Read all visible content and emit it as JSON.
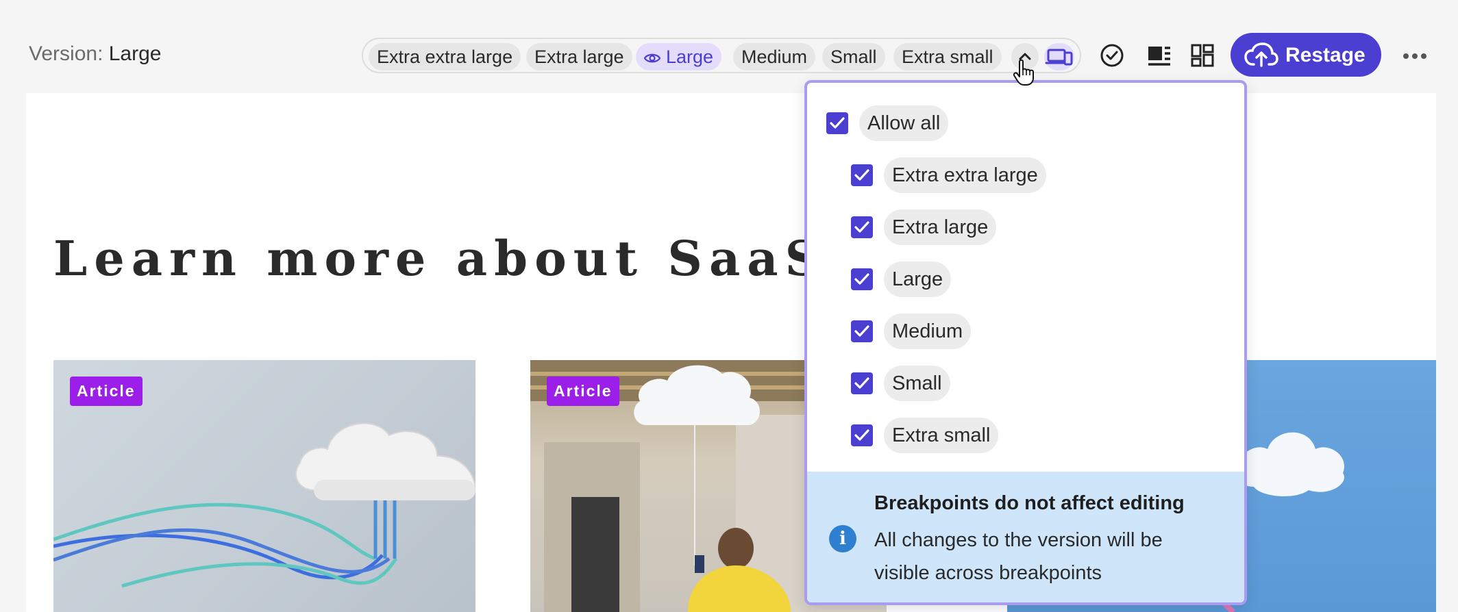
{
  "header": {
    "version_label": "Version:",
    "version_value": "Large"
  },
  "breakpoints_bar": {
    "chips": [
      {
        "label": "Extra extra large",
        "active": false
      },
      {
        "label": "Extra large",
        "active": false
      },
      {
        "label": "Large",
        "active": true
      },
      {
        "label": "Medium",
        "active": false
      },
      {
        "label": "Small",
        "active": false
      },
      {
        "label": "Extra small",
        "active": false
      }
    ],
    "toggle_icon": "chevron-up-icon",
    "devices_icon": "devices-icon"
  },
  "toolbar": {
    "check_icon": "check-circle-icon",
    "layout_icon": "image-text-icon",
    "grid_icon": "dashboard-grid-icon",
    "restage_label": "Restage",
    "restage_icon": "cloud-upload-icon",
    "more_icon": "more-horizontal-icon"
  },
  "canvas": {
    "headline": "Learn more about SaaS conte",
    "cards": [
      {
        "badge": "Article"
      },
      {
        "badge": "Article"
      },
      {
        "badge": ""
      }
    ]
  },
  "dropdown": {
    "allow_all_label": "Allow all",
    "allow_all_checked": true,
    "options": [
      {
        "label": "Extra extra large",
        "checked": true
      },
      {
        "label": "Extra large",
        "checked": true
      },
      {
        "label": "Large",
        "checked": true
      },
      {
        "label": "Medium",
        "checked": true
      },
      {
        "label": "Small",
        "checked": true
      },
      {
        "label": "Extra small",
        "checked": true
      }
    ],
    "info": {
      "icon": "info-icon",
      "title": "Breakpoints do not affect editing",
      "body": "All changes to the version will be visible across breakpoints"
    }
  },
  "colors": {
    "accent": "#4a3fd0",
    "badge": "#9b1fe8",
    "info_bg": "#cfe6fa"
  }
}
